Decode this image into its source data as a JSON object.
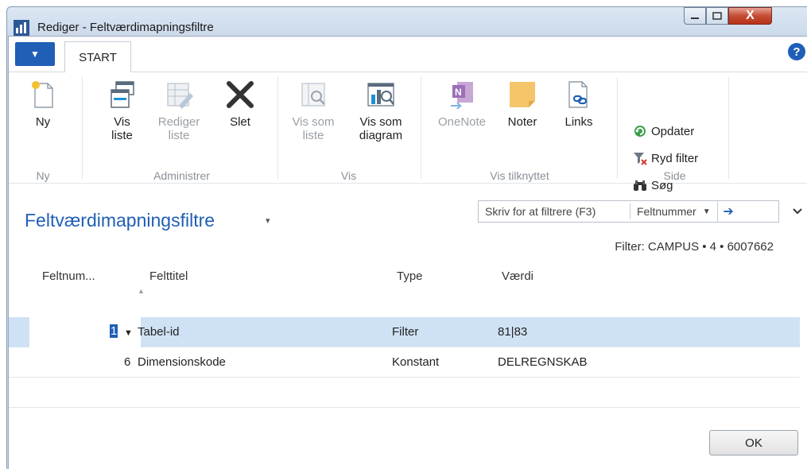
{
  "window": {
    "title": "Rediger - Feltværdimapningsfiltre",
    "close_label": "X"
  },
  "tabs": {
    "menu_arrow": "▼",
    "start": "START",
    "help": "?"
  },
  "ribbon": {
    "ny": "Ny",
    "vis_liste": "Vis\nliste",
    "rediger_liste": "Rediger\nliste",
    "slet": "Slet",
    "vis_som_liste": "Vis som\nliste",
    "vis_som_diagram": "Vis som\ndiagram",
    "onenote": "OneNote",
    "noter": "Noter",
    "links": "Links",
    "opdater": "Opdater",
    "ryd_filter": "Ryd filter",
    "sog": "Søg",
    "groups": {
      "ny": "Ny",
      "administrer": "Administrer",
      "vis": "Vis",
      "vis_tilknyttet": "Vis tilknyttet",
      "side": "Side"
    }
  },
  "page": {
    "title": "Feltværdimapningsfiltre",
    "search_placeholder": "Skriv for at filtrere (F3)",
    "search_field": "Feltnummer",
    "filter": "Filter: CAMPUS • 4 • 6007662"
  },
  "table": {
    "headers": {
      "feltnummer": "Feltnum...",
      "felttitel": "Felttitel",
      "type": "Type",
      "vaerdi": "Værdi"
    },
    "rows": [
      {
        "feltnummer": "1",
        "felttitel": "Tabel-id",
        "type": "Filter",
        "vaerdi": "81|83"
      },
      {
        "feltnummer": "6",
        "felttitel": "Dimensionskode",
        "type": "Konstant",
        "vaerdi": "DELREGNSKAB"
      }
    ]
  },
  "footer": {
    "ok": "OK"
  },
  "colors": {
    "accent": "#1f5fb5",
    "selected_row": "#cfe2f5"
  }
}
